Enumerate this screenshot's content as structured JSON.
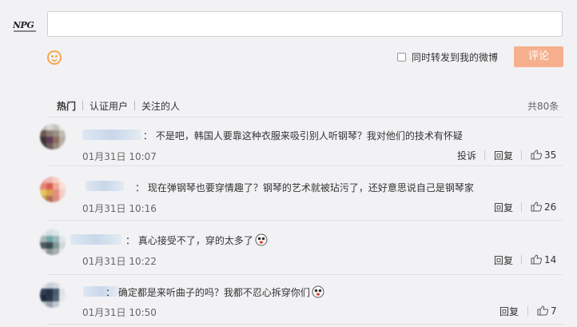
{
  "logo": {
    "text": "NPG"
  },
  "composer": {
    "input_value": "",
    "emoji_icon": "smile-icon",
    "checkbox_checked": false,
    "repost_label": "同时转发到我的微博",
    "submit_label": "评论"
  },
  "tabs": {
    "items": [
      "热门",
      "认证用户",
      "关注的人"
    ],
    "active": "热门",
    "total": "共80条"
  },
  "comments": [
    {
      "text": "不是吧，韩国人要靠这种衣服来吸引别人听钢琴？我对他们的技术有怀疑",
      "time": "01月31日 10:07",
      "report_label": "投诉",
      "reply_label": "回复",
      "likes": "35",
      "has_emoji": false
    },
    {
      "text": "现在弹钢琴也要穿情趣了？钢琴的艺术就被玷污了，还好意思说自己是钢琴家",
      "time": "01月31日 10:16",
      "reply_label": "回复",
      "likes": "26",
      "has_emoji": false
    },
    {
      "text": "真心接受不了，穿的太多了",
      "time": "01月31日 10:22",
      "reply_label": "回复",
      "likes": "14",
      "has_emoji": true
    },
    {
      "text": "确定都是来听曲子的吗？我都不忍心拆穿你们",
      "time": "01月31日 10:50",
      "reply_label": "回复",
      "likes": "7",
      "has_emoji": true
    }
  ],
  "colors": {
    "accent": "#f7b08d",
    "emoji": "#f4a64b",
    "link": "#333333"
  }
}
